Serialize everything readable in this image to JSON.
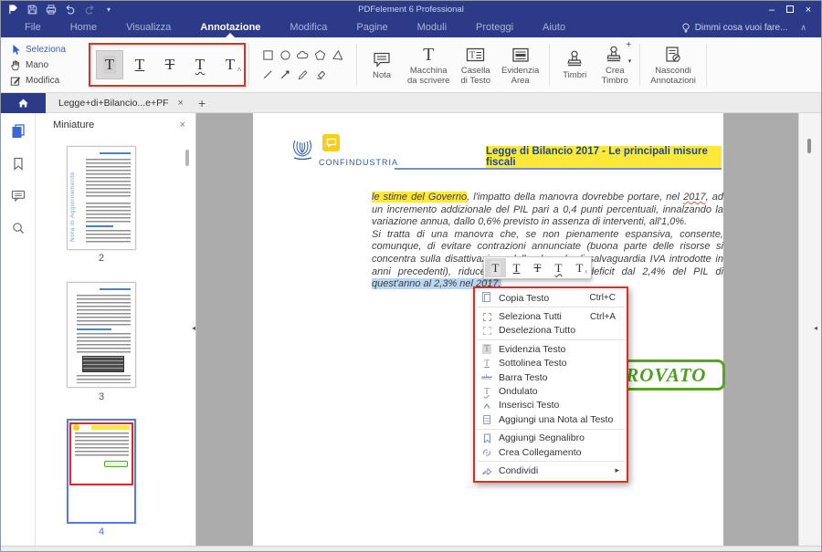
{
  "titlebar": {
    "title": "PDFelement 6 Professional"
  },
  "glyphs": {
    "minimize": "–",
    "close": "×",
    "caret_down": "▾",
    "chevron_up": "∧",
    "tab_close": "×",
    "tab_add": "+",
    "panel_close": "×",
    "submenu_arrow": "▸",
    "splitter_left": "◂",
    "stamp_plus": "+",
    "stamp_caret": "▾",
    "t_letter": "T",
    "abc": "abc"
  },
  "menubar": {
    "items": [
      "File",
      "Home",
      "Visualizza",
      "Annotazione",
      "Modifica",
      "Pagine",
      "Moduli",
      "Proteggi",
      "Aiuto"
    ],
    "active": "Annotazione",
    "search": "Dimmi cosa vuoi fare..."
  },
  "toolbar": {
    "seleziona": "Seleziona",
    "mano": "Mano",
    "modifica": "Modifica",
    "nota": "Nota",
    "macchina1": "Macchina",
    "macchina2": "da scrivere",
    "casella1": "Casella",
    "casella2": "di Testo",
    "evidenzia1": "Evidenzia",
    "evidenzia2": "Area",
    "timbri": "Timbri",
    "crea1": "Crea",
    "crea2": "Timbro",
    "nascondi1": "Nascondi",
    "nascondi2": "Annotazioni"
  },
  "tabbar": {
    "tab_label": "Legge+di+Bilancio...e+PF"
  },
  "sidebar": {
    "panel_title": "Miniature",
    "page2": "2",
    "page3": "3",
    "page4": "4",
    "page2_vtext": "Nota di Aggiornamento"
  },
  "doc": {
    "brand": "CONFINDUSTRIA",
    "header_title": "Legge di Bilancio 2017 -  Le principali misure fiscali",
    "p1_hl": "le stime del Governo",
    "p1_a": ", l'impatto della manovra dovrebbe portare, nel ",
    "p1_year": "2017",
    "p1_b": ", ad un incremento addizionale del PIL pari a 0,4 punti percentuali, innalzando la variazione annua, dallo 0,6% previsto in assenza di interventi, all'1,0%.",
    "p2_a": "Si tratta di una manovra che, se non pienamente espansiva, consente, comunque, di evitare contrazioni annunciate (buona parte delle risorse si concentra sulla disattivazione delle clausole di salvaguardia IVA introdotte in anni precedenti), riducendo al contempo il deficit dal 2,4% del PIL di ",
    "p2_sel": "quest'anno al 2,3% nel 2017.",
    "stamp": "APPROVATO"
  },
  "context_menu": {
    "items": [
      {
        "label": "Copia Testo",
        "shortcut": "Ctrl+C"
      },
      {
        "label": "Seleziona Tutti",
        "shortcut": "Ctrl+A"
      },
      {
        "label": "Deseleziona Tutto",
        "shortcut": ""
      },
      {
        "label": "Evidenzia Testo",
        "shortcut": ""
      },
      {
        "label": "Sottolinea Testo",
        "shortcut": ""
      },
      {
        "label": "Barra Testo",
        "shortcut": ""
      },
      {
        "label": "Ondulato",
        "shortcut": ""
      },
      {
        "label": "Inserisci Testo",
        "shortcut": ""
      },
      {
        "label": "Aggiungi una Nota al Testo",
        "shortcut": ""
      },
      {
        "label": "Aggiungi Segnalibro",
        "shortcut": ""
      },
      {
        "label": "Crea Collegamento",
        "shortcut": ""
      },
      {
        "label": "Condividi",
        "shortcut": ""
      }
    ]
  },
  "colors": {
    "header_navy": "#2c3b87",
    "annotation_red": "#e8291f",
    "highlight_yellow": "#ffe838",
    "stamp_green": "#4ba11d",
    "selection_blue": "#b9d6f2",
    "accent_blue": "#2f5fd0"
  }
}
